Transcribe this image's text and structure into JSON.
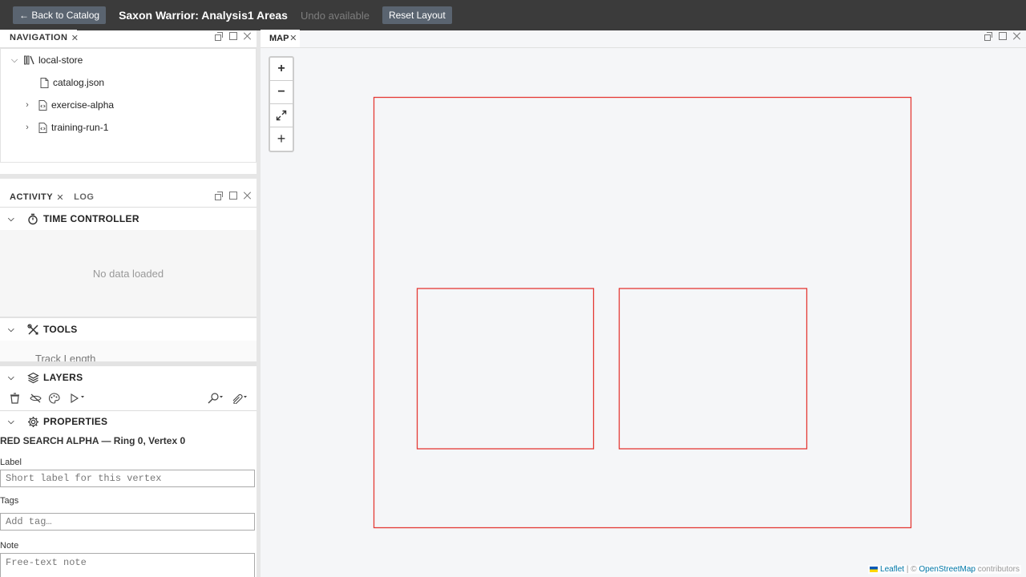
{
  "topbar": {
    "back_label": "← Back to Catalog",
    "title": "Saxon Warrior: Analysis1 Areas",
    "undo_label": "Undo available",
    "reset_label": "Reset Layout"
  },
  "navigation": {
    "tab_label": "NAVIGATION",
    "items": [
      {
        "label": "local-store",
        "icon": "library-icon",
        "expanded": true
      },
      {
        "label": "catalog.json",
        "icon": "file-icon"
      },
      {
        "label": "exercise-alpha",
        "icon": "code-file-icon",
        "expanded": false
      },
      {
        "label": "training-run-1",
        "icon": "code-file-icon",
        "expanded": false
      }
    ]
  },
  "activity": {
    "tabs": [
      {
        "label": "ACTIVITY"
      },
      {
        "label": "LOG"
      }
    ],
    "time_controller": {
      "title": "TIME CONTROLLER",
      "empty": "No data loaded"
    },
    "tools": {
      "title": "TOOLS",
      "first_item": "Track Length"
    },
    "layers": {
      "title": "LAYERS"
    },
    "properties": {
      "title": "PROPERTIES",
      "subject": "RED SEARCH ALPHA — Ring 0, Vertex 0",
      "label_field": {
        "label": "Label",
        "placeholder": "Short label for this vertex"
      },
      "tags_field": {
        "label": "Tags",
        "placeholder": "Add tag…"
      },
      "note_field": {
        "label": "Note",
        "placeholder": "Free-text note"
      }
    }
  },
  "map": {
    "tab_label": "MAP",
    "attribution": {
      "leaflet": "Leaflet",
      "sep": " | © ",
      "osm": "OpenStreetMap",
      "suffix": " contributors"
    },
    "polygon_color": "#e53935"
  }
}
